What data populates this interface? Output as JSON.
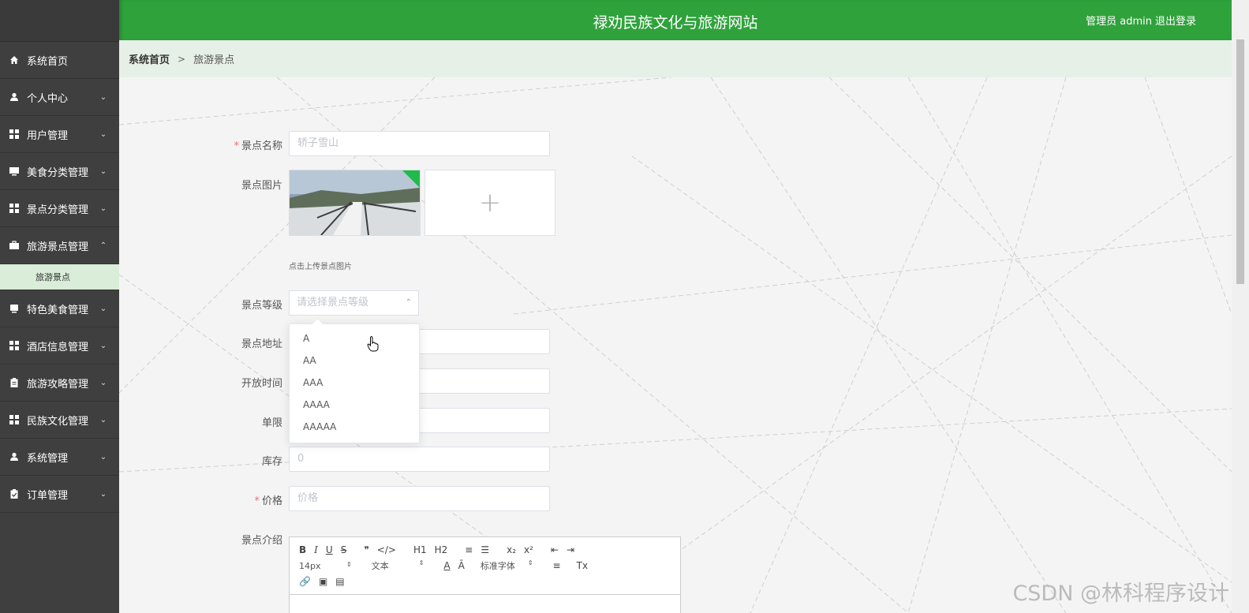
{
  "header": {
    "title": "禄劝民族文化与旅游网站",
    "user": "管理员 admin",
    "logout": "退出登录"
  },
  "breadcrumb": {
    "home": "系统首页",
    "separator": ">",
    "current": "旅游景点"
  },
  "sidebar": {
    "items": [
      {
        "label": "系统首页",
        "icon": "home-icon",
        "chevron": ""
      },
      {
        "label": "个人中心",
        "icon": "user-icon",
        "chevron": "⌄"
      },
      {
        "label": "用户管理",
        "icon": "grid-icon",
        "chevron": "⌄"
      },
      {
        "label": "美食分类管理",
        "icon": "monitor-icon",
        "chevron": "⌄"
      },
      {
        "label": "景点分类管理",
        "icon": "grid-icon",
        "chevron": "⌄"
      },
      {
        "label": "旅游景点管理",
        "icon": "briefcase-icon",
        "chevron": "⌃"
      },
      {
        "label": "特色美食管理",
        "icon": "tablet-icon",
        "chevron": "⌄"
      },
      {
        "label": "酒店信息管理",
        "icon": "grid-icon",
        "chevron": "⌄"
      },
      {
        "label": "旅游攻略管理",
        "icon": "clipboard-icon",
        "chevron": "⌄"
      },
      {
        "label": "民族文化管理",
        "icon": "grid-icon",
        "chevron": "⌄"
      },
      {
        "label": "系统管理",
        "icon": "user-icon",
        "chevron": "⌄"
      },
      {
        "label": "订单管理",
        "icon": "clipboard-check-icon",
        "chevron": "⌄"
      }
    ],
    "submenu": {
      "label": "旅游景点"
    }
  },
  "form": {
    "name": {
      "label": "景点名称",
      "required": "*",
      "value": "轿子雪山"
    },
    "image": {
      "label": "景点图片",
      "hint": "点击上传景点图片",
      "add": "+"
    },
    "level": {
      "label": "景点等级",
      "placeholder": "请选择景点等级",
      "arrow": "⌃",
      "options": [
        "A",
        "AA",
        "AAA",
        "AAAA",
        "AAAAA"
      ]
    },
    "address": {
      "label": "景点地址"
    },
    "open_time": {
      "label": "开放时间"
    },
    "limit": {
      "label": "单限"
    },
    "stock": {
      "label": "库存",
      "value": "0"
    },
    "price": {
      "label": "价格",
      "required": "*",
      "placeholder": "价格"
    },
    "intro": {
      "label": "景点介绍"
    }
  },
  "editor": {
    "row1": [
      "B",
      "I",
      "U",
      "S",
      "❞",
      "</>",
      "H1",
      "H2",
      "≡",
      "☰",
      "x₂",
      "x²",
      "⇤",
      "⇥"
    ],
    "font_size": "14px",
    "text_style": "文本",
    "font_family": "标准字体",
    "row2_icons": [
      "A",
      "Ā",
      "≡",
      "Tx"
    ],
    "row3_icons": [
      "🔗",
      "▣",
      "▤"
    ]
  },
  "watermark": "CSDN @林科程序设计",
  "colors": {
    "header": "#2fa23c",
    "sidebar": "#3f3f3f",
    "submenu": "#d9edd9",
    "crumb": "#e6f0e6"
  }
}
